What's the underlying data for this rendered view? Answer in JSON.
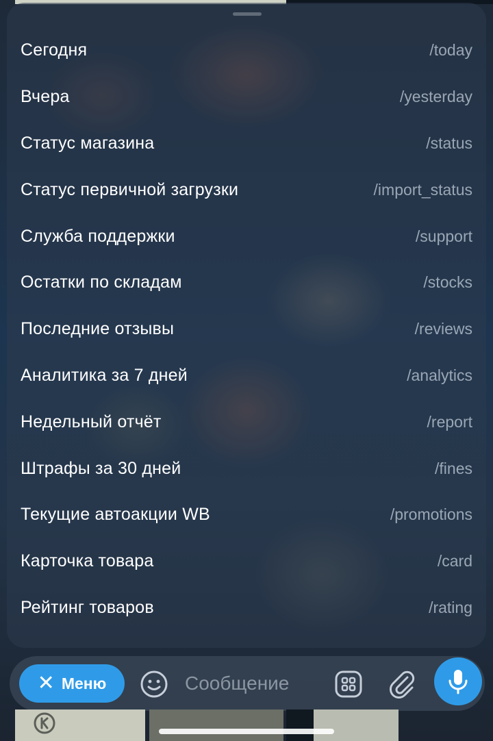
{
  "commands": [
    {
      "label": "Сегодня",
      "command": "/today"
    },
    {
      "label": "Вчера",
      "command": "/yesterday"
    },
    {
      "label": "Статус магазина",
      "command": "/status"
    },
    {
      "label": "Статус первичной загрузки",
      "command": "/import_status"
    },
    {
      "label": "Служба поддержки",
      "command": "/support"
    },
    {
      "label": "Остатки по складам",
      "command": "/stocks"
    },
    {
      "label": "Последние отзывы",
      "command": "/reviews"
    },
    {
      "label": "Аналитика за 7 дней",
      "command": "/analytics"
    },
    {
      "label": "Недельный отчёт",
      "command": "/report"
    },
    {
      "label": "Штрафы за 30 дней",
      "command": "/fines"
    },
    {
      "label": "Текущие автоакции WB",
      "command": "/promotions"
    },
    {
      "label": "Карточка товара",
      "command": "/card"
    },
    {
      "label": "Рейтинг товаров",
      "command": "/rating"
    }
  ],
  "input_bar": {
    "menu_button_label": "Меню",
    "menu_button_icon": "close-icon",
    "emoji_icon": "emoji-icon",
    "message_placeholder": "Сообщение",
    "apps_icon": "apps-grid-icon",
    "attach_icon": "paperclip-icon",
    "mic_icon": "microphone-icon"
  },
  "colors": {
    "accent": "#2f9be8",
    "text_primary": "#ffffff",
    "text_secondary": "#b4bfcc"
  }
}
